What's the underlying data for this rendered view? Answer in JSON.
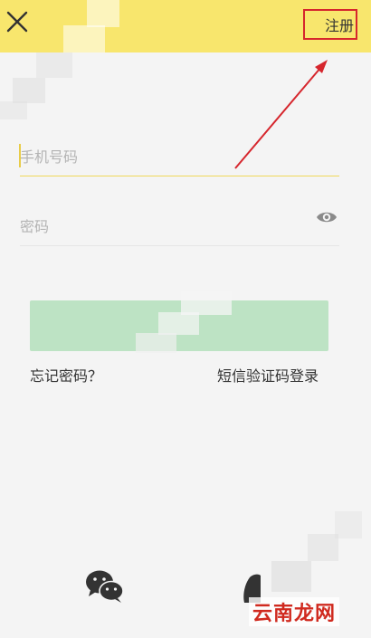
{
  "header": {
    "close_icon": "close-icon",
    "register_label": "注册"
  },
  "form": {
    "phone_placeholder": "手机号码",
    "password_placeholder": "密码",
    "password_toggle_icon": "eye-icon",
    "login_label": ""
  },
  "links": {
    "forgot_password": "忘记密码？",
    "sms_login": "短信验证码登录"
  },
  "third_party": {
    "icons": [
      "wechat-icon",
      "qq-icon"
    ]
  },
  "watermark": "云南龙网",
  "colors": {
    "header_bg": "#f8e66d",
    "button_bg": "#bde3c4",
    "annotation": "#d6262d",
    "input_focus_line": "#f0d95a"
  }
}
